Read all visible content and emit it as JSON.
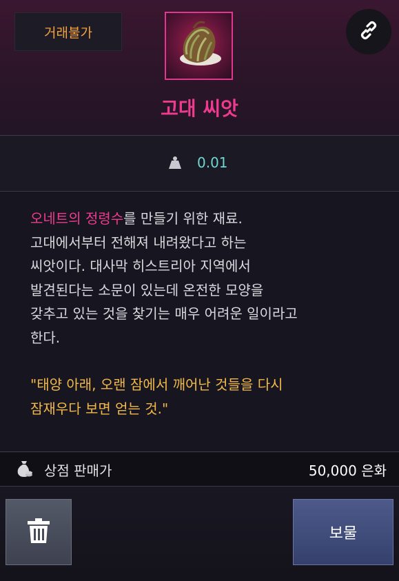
{
  "item": {
    "trade_badge": "거래불가",
    "name": "고대 씨앗",
    "weight": "0.01"
  },
  "description": {
    "highlight": "오네트의 정령수",
    "line1_rest": "를 만들기 위한 재료.",
    "lines": [
      "고대에서부터 전해져 내려왔다고 하는",
      "씨앗이다. 대사막 히스트리아 지역에서",
      "발견된다는 소문이 있는데 온전한 모양을",
      "갖추고 있는 것을 찾기는 매우 어려운 일이라고",
      "한다."
    ],
    "quote_lines": [
      "\"태양 아래, 오랜 잠에서 깨어난 것들을 다시",
      "잠재우다 보면 얻는 것.\""
    ]
  },
  "price": {
    "label": "상점 판매가",
    "value": "50,000 은화"
  },
  "buttons": {
    "treasure": "보물"
  },
  "colors": {
    "name": "#ee3a8f",
    "badge": "#f3a23e",
    "weight": "#6fd7d2",
    "quote": "#f2b94a"
  },
  "icons": [
    "link-icon",
    "weight-icon",
    "money-bag-icon",
    "trash-icon",
    "seed-item-icon"
  ]
}
